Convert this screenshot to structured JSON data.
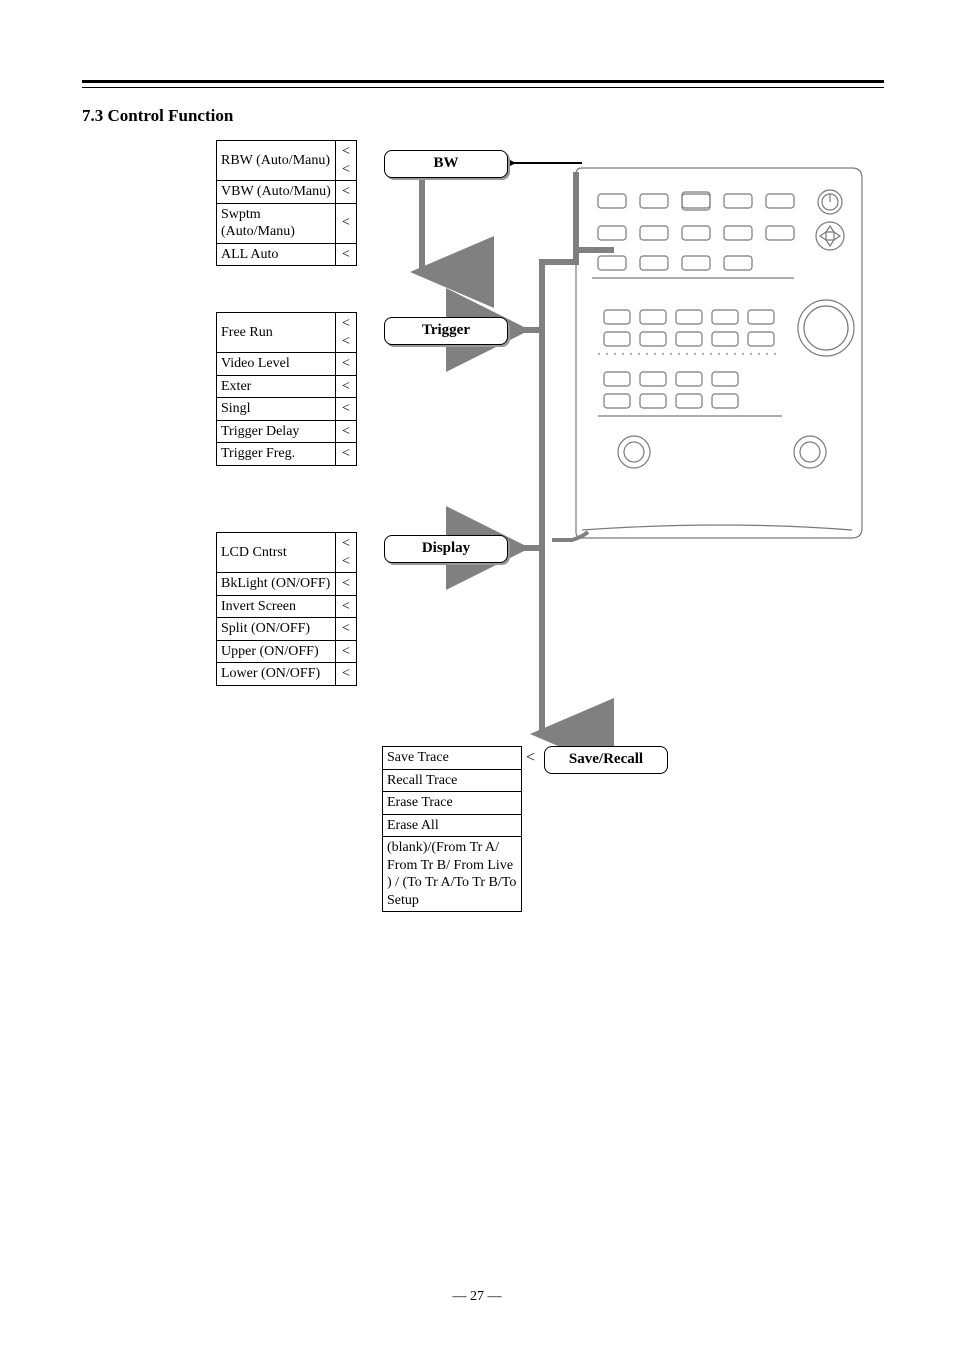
{
  "heading": "7.3 Control Function",
  "bw": {
    "label": "BW",
    "items": [
      {
        "text": "RBW (Auto/Manu)",
        "arr": "< <"
      },
      {
        "text": "VBW (Auto/Manu)",
        "arr": "<"
      },
      {
        "text": "Swptm (Auto/Manu)",
        "arr": "<"
      },
      {
        "text": "ALL Auto",
        "arr": "<"
      }
    ]
  },
  "trigger": {
    "label": "Trigger",
    "items": [
      {
        "text": "Free Run",
        "arr": "< <"
      },
      {
        "text": "Video Level",
        "arr": "<"
      },
      {
        "text": "Exter",
        "arr": "<"
      },
      {
        "text": "Singl",
        "arr": "<"
      },
      {
        "text": "Trigger Delay",
        "arr": "<"
      },
      {
        "text": "Trigger Freg.",
        "arr": "<"
      }
    ]
  },
  "display": {
    "label": "Display",
    "items": [
      {
        "text": "LCD Cntrst",
        "arr": "< <"
      },
      {
        "text": "BkLight (ON/OFF)",
        "arr": "<"
      },
      {
        "text": "Invert Screen",
        "arr": "<"
      },
      {
        "text": "Split (ON/OFF)",
        "arr": "<"
      },
      {
        "text": "Upper (ON/OFF)",
        "arr": "<"
      },
      {
        "text": "Lower (ON/OFF)",
        "arr": "<"
      }
    ]
  },
  "save_recall": {
    "label": "Save/Recall",
    "first_arr": "<",
    "items": [
      {
        "text": "Save Trace"
      },
      {
        "text": "Recall Trace"
      },
      {
        "text": "Erase Trace"
      },
      {
        "text": "Erase All"
      },
      {
        "text": "(blank)/(From Tr A/ From Tr B/ From Live ) / (To Tr A/To Tr B/To Setup"
      }
    ]
  },
  "page_number": "27"
}
